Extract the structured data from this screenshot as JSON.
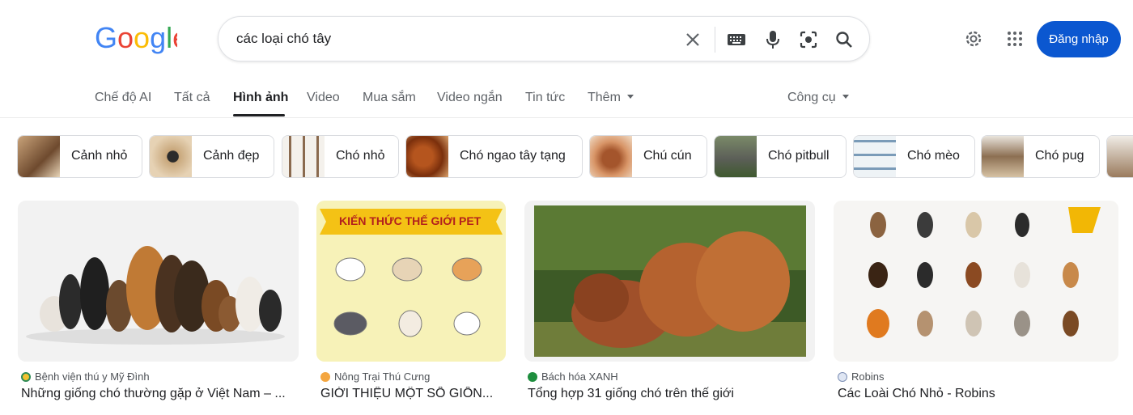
{
  "search": {
    "query": "các loại chó tây"
  },
  "header": {
    "signin_label": "Đăng nhập"
  },
  "tabs": [
    "Chế độ AI",
    "Tất cả",
    "Hình ảnh",
    "Video",
    "Mua sắm",
    "Video ngắn",
    "Tin tức",
    "Thêm"
  ],
  "tools_label": "Công cụ",
  "chips": [
    "Cảnh nhỏ",
    "Cảnh đẹp",
    "Chó nhỏ",
    "Chó ngao tây tạng",
    "Chú cún",
    "Chó pitbull",
    "Chó mèo",
    "Chó pug"
  ],
  "results": [
    {
      "source": "Bệnh viện thú y Mỹ Đình",
      "title": "Những giống chó thường gặp ở Việt Nam – ..."
    },
    {
      "source": "Nông Trại Thú Cưng",
      "title": "GIỚI THIỆU MỘT SỐ GIỐN...",
      "banner": "KIẾN THỨC THẾ GIỚI PET"
    },
    {
      "source": "Bách hóa XANH",
      "title": "Tổng hợp 31 giống chó trên thế giới"
    },
    {
      "source": "Robins",
      "title": "Các Loài Chó Nhỏ - Robins"
    }
  ],
  "colors": {
    "brand_blue": "#4285F4",
    "brand_red": "#EA4335",
    "brand_yellow": "#FBBC05",
    "brand_green": "#34A853",
    "signin_bg": "#0b57d0"
  },
  "icons": [
    "google-logo",
    "clear-icon",
    "keyboard-icon",
    "mic-icon",
    "lens-icon",
    "search-icon",
    "gear-icon",
    "apps-grid-icon",
    "caret-down-icon"
  ]
}
